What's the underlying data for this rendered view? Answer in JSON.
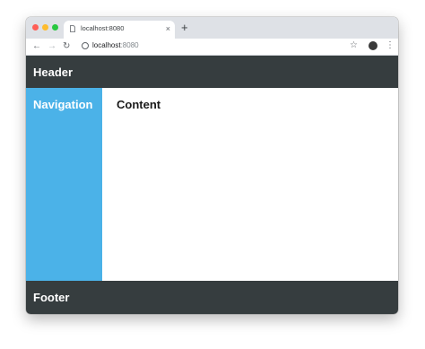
{
  "browser": {
    "tab": {
      "title": "localhost:8080",
      "close_glyph": "×"
    },
    "new_tab_glyph": "+",
    "toolbar": {
      "back_glyph": "←",
      "forward_glyph": "→",
      "reload_glyph": "↻",
      "url_host": "localhost",
      "url_port": ":8080",
      "star_glyph": "☆",
      "menu_glyph": "⋮"
    },
    "icons": [
      "page-icon",
      "info-icon",
      "star-icon",
      "profile-avatar",
      "kebab-menu-icon"
    ]
  },
  "page": {
    "header": "Header",
    "navigation": "Navigation",
    "content": "Content",
    "footer": "Footer"
  },
  "colors": {
    "header_bg": "#363d3f",
    "nav_bg": "#4bb2e8",
    "content_bg": "#ffffff",
    "footer_bg": "#363d3f",
    "tabstrip_bg": "#dee1e6"
  }
}
